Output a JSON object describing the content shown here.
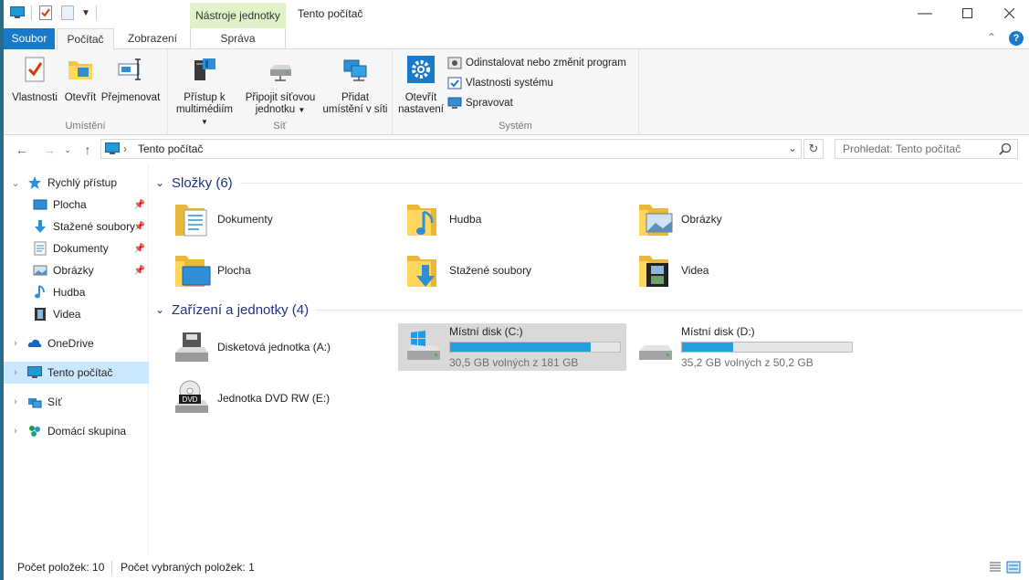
{
  "titlebar": {
    "context_tab": "Nástroje jednotky",
    "title": "Tento počítač"
  },
  "tabs": {
    "file": "Soubor",
    "computer": "Počítač",
    "view": "Zobrazení",
    "manage": "Správa"
  },
  "ribbon": {
    "location_group": "Umístění",
    "network_group": "Síť",
    "system_group": "Systém",
    "properties": "Vlastnosti",
    "open": "Otevřít",
    "rename": "Přejmenovat",
    "media_access_1": "Přístup k",
    "media_access_2": "multimédiím",
    "map_drive_1": "Připojit síťovou",
    "map_drive_2": "jednotku",
    "add_location_1": "Přidat",
    "add_location_2": "umístění v síti",
    "open_settings_1": "Otevřít",
    "open_settings_2": "nastavení",
    "uninstall": "Odinstalovat nebo změnit program",
    "system_props": "Vlastnosti systému",
    "manage": "Spravovat"
  },
  "address": {
    "path": "Tento počítač",
    "search_placeholder": "Prohledat: Tento počítač"
  },
  "nav": {
    "quick_access": "Rychlý přístup",
    "desktop": "Plocha",
    "downloads": "Stažené soubory",
    "documents": "Dokumenty",
    "pictures": "Obrázky",
    "music": "Hudba",
    "videos": "Videa",
    "onedrive": "OneDrive",
    "this_pc": "Tento počítač",
    "network": "Síť",
    "homegroup": "Domácí skupina"
  },
  "content": {
    "folders_title": "Složky (6)",
    "devices_title": "Zařízení a jednotky (4)",
    "folders": {
      "documents": "Dokumenty",
      "music": "Hudba",
      "pictures": "Obrázky",
      "desktop": "Plocha",
      "downloads": "Stažené soubory",
      "videos": "Videa"
    },
    "drives": {
      "floppy": "Disketová jednotka (A:)",
      "c_name": "Místní disk (C:)",
      "c_free": "30,5 GB volných z 181 GB",
      "c_used_fraction": 0.83,
      "d_name": "Místní disk (D:)",
      "d_free": "35,2 GB volných z 50,2 GB",
      "d_used_fraction": 0.3,
      "dvd": "Jednotka DVD RW (E:)",
      "dvd_badge": "DVD"
    }
  },
  "status": {
    "count": "Počet položek: 10",
    "selected": "Počet vybraných položek: 1"
  },
  "colors": {
    "accent": "#1979ca",
    "bar_fill": "#26a0da",
    "section_title": "#1e3287",
    "selection": "#cce8ff"
  }
}
